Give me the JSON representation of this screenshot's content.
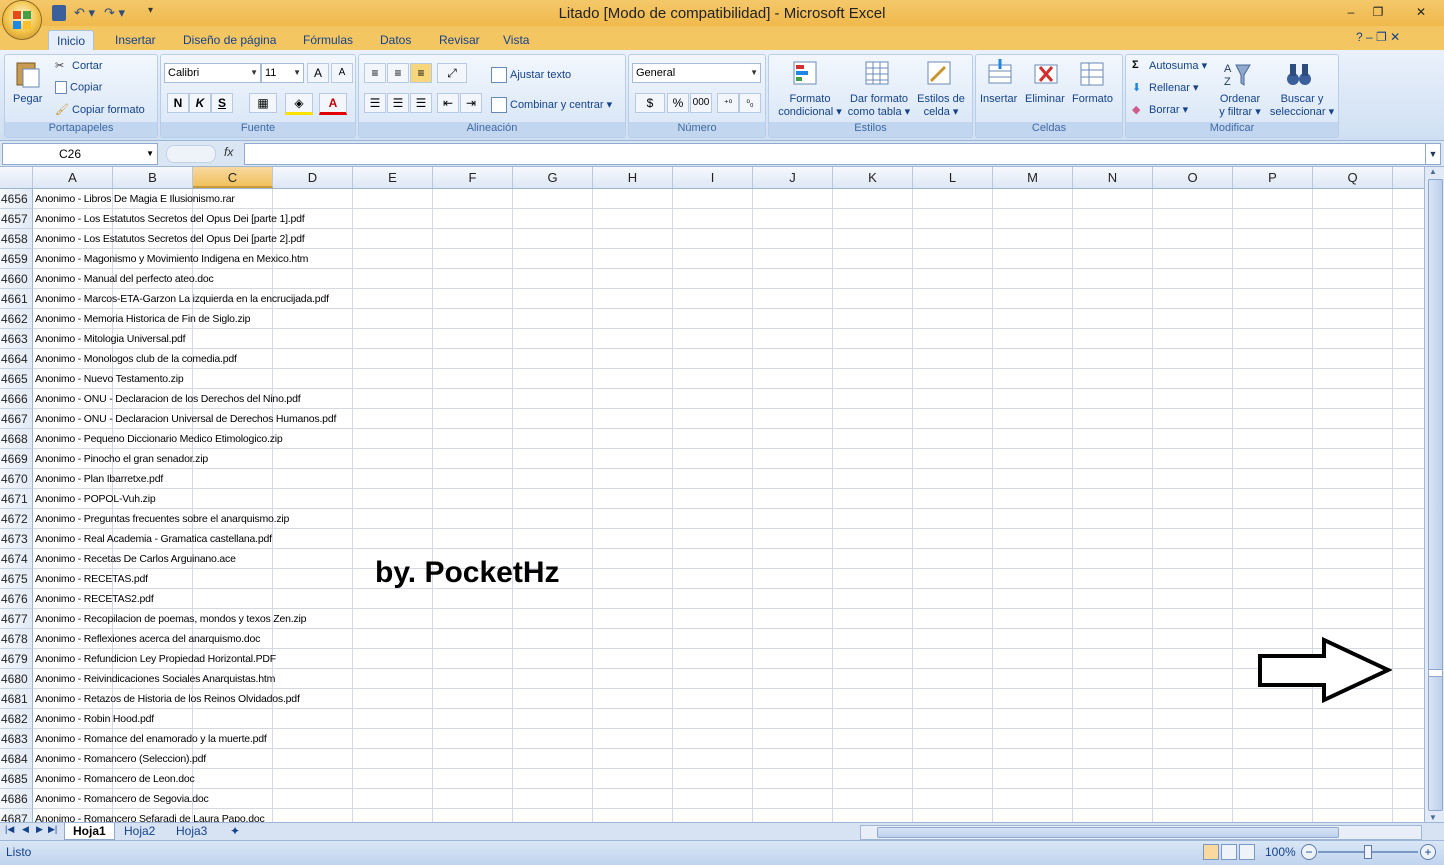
{
  "window": {
    "title": "Litado  [Modo de compatibilidad] - Microsoft Excel",
    "min": "–",
    "max": "❐",
    "close": "✕"
  },
  "qat": {
    "undo": "↶ ▾",
    "redo": "↷ ▾",
    "more": "▾"
  },
  "ribbon_tabs": [
    "Inicio",
    "Insertar",
    "Diseño de página",
    "Fórmulas",
    "Datos",
    "Revisar",
    "Vista"
  ],
  "help": "?   –   ❐   ✕",
  "clipboard": {
    "paste": "Pegar",
    "cut": "Cortar",
    "copy": "Copiar",
    "format_painter": "Copiar formato",
    "label": "Portapapeles"
  },
  "font": {
    "name": "Calibri",
    "size": "11",
    "bold": "N",
    "italic": "K",
    "underline": "S",
    "label": "Fuente"
  },
  "alignment": {
    "wrap": "Ajustar texto",
    "merge": "Combinar y centrar",
    "label": "Alineación"
  },
  "number": {
    "format": "General",
    "currency": "$",
    "percent": "%",
    "thousands": "000",
    "label": "Número"
  },
  "styles": {
    "cond_format_1": "Formato",
    "cond_format_2": "condicional",
    "table_format_1": "Dar formato",
    "table_format_2": "como tabla",
    "cell_styles_1": "Estilos de",
    "cell_styles_2": "celda",
    "label": "Estilos"
  },
  "cells": {
    "insert": "Insertar",
    "delete": "Eliminar",
    "format": "Formato",
    "label": "Celdas"
  },
  "editing": {
    "autosum": "Autosuma",
    "fill": "Rellenar",
    "clear": "Borrar",
    "sort_1": "Ordenar",
    "sort_2": "y filtrar",
    "find_1": "Buscar y",
    "find_2": "seleccionar",
    "label": "Modificar"
  },
  "formula_bar": {
    "name_box": "C26",
    "fx": "fx",
    "value": ""
  },
  "columns": [
    "A",
    "B",
    "C",
    "D",
    "E",
    "F",
    "G",
    "H",
    "I",
    "J",
    "K",
    "L",
    "M",
    "N",
    "O",
    "P",
    "Q"
  ],
  "selected_column": "C",
  "rows": [
    {
      "n": "4656",
      "a": "Anonimo - Libros De Magia E Ilusionismo.rar"
    },
    {
      "n": "4657",
      "a": "Anonimo - Los Estatutos Secretos del Opus Dei [parte 1].pdf"
    },
    {
      "n": "4658",
      "a": "Anonimo - Los Estatutos Secretos del Opus Dei [parte 2].pdf"
    },
    {
      "n": "4659",
      "a": "Anonimo - Magonismo y Movimiento Indigena en Mexico.htm"
    },
    {
      "n": "4660",
      "a": "Anonimo - Manual del perfecto ateo.doc"
    },
    {
      "n": "4661",
      "a": "Anonimo - Marcos-ETA-Garzon La izquierda en la encrucijada.pdf"
    },
    {
      "n": "4662",
      "a": "Anonimo - Memoria Historica de Fin de Siglo.zip"
    },
    {
      "n": "4663",
      "a": "Anonimo - Mitologia Universal.pdf"
    },
    {
      "n": "4664",
      "a": "Anonimo - Monologos club de la comedia.pdf"
    },
    {
      "n": "4665",
      "a": "Anonimo - Nuevo Testamento.zip"
    },
    {
      "n": "4666",
      "a": "Anonimo - ONU - Declaracion de los Derechos del Nino.pdf"
    },
    {
      "n": "4667",
      "a": "Anonimo - ONU - Declaracion Universal de Derechos Humanos.pdf"
    },
    {
      "n": "4668",
      "a": "Anonimo - Pequeno Diccionario Medico Etimologico.zip"
    },
    {
      "n": "4669",
      "a": "Anonimo - Pinocho el gran senador.zip"
    },
    {
      "n": "4670",
      "a": "Anonimo - Plan Ibarretxe.pdf"
    },
    {
      "n": "4671",
      "a": "Anonimo - POPOL-Vuh.zip"
    },
    {
      "n": "4672",
      "a": "Anonimo - Preguntas frecuentes sobre el anarquismo.zip"
    },
    {
      "n": "4673",
      "a": "Anonimo - Real Academia - Gramatica castellana.pdf"
    },
    {
      "n": "4674",
      "a": "Anonimo - Recetas De Carlos Arguinano.ace"
    },
    {
      "n": "4675",
      "a": "Anonimo - RECETAS.pdf"
    },
    {
      "n": "4676",
      "a": "Anonimo - RECETAS2.pdf"
    },
    {
      "n": "4677",
      "a": "Anonimo - Recopilacion de poemas, mondos y texos Zen.zip"
    },
    {
      "n": "4678",
      "a": "Anonimo - Reflexiones acerca del anarquismo.doc"
    },
    {
      "n": "4679",
      "a": "Anonimo - Refundicion Ley Propiedad Horizontal.PDF"
    },
    {
      "n": "4680",
      "a": "Anonimo - Reivindicaciones Sociales Anarquistas.htm"
    },
    {
      "n": "4681",
      "a": "Anonimo - Retazos de Historia de los Reinos Olvidados.pdf"
    },
    {
      "n": "4682",
      "a": "Anonimo - Robin Hood.pdf"
    },
    {
      "n": "4683",
      "a": "Anonimo - Romance del enamorado y la muerte.pdf"
    },
    {
      "n": "4684",
      "a": "Anonimo - Romancero (Seleccion).pdf"
    },
    {
      "n": "4685",
      "a": "Anonimo - Romancero de Leon.doc"
    },
    {
      "n": "4686",
      "a": "Anonimo - Romancero de Segovia.doc"
    },
    {
      "n": "4687",
      "a": "Anonimo - Romancero Sefaradi de Laura Papo.doc"
    }
  ],
  "watermark": "by. PocketHz",
  "sheets": [
    "Hoja1",
    "Hoja2",
    "Hoja3"
  ],
  "active_sheet": "Hoja1",
  "status": "Listo",
  "zoom": "100%",
  "colors": {
    "title_bar": "#f0b94c",
    "ribbon": "#dbe6f4",
    "selected_col": "#f1c15f"
  }
}
